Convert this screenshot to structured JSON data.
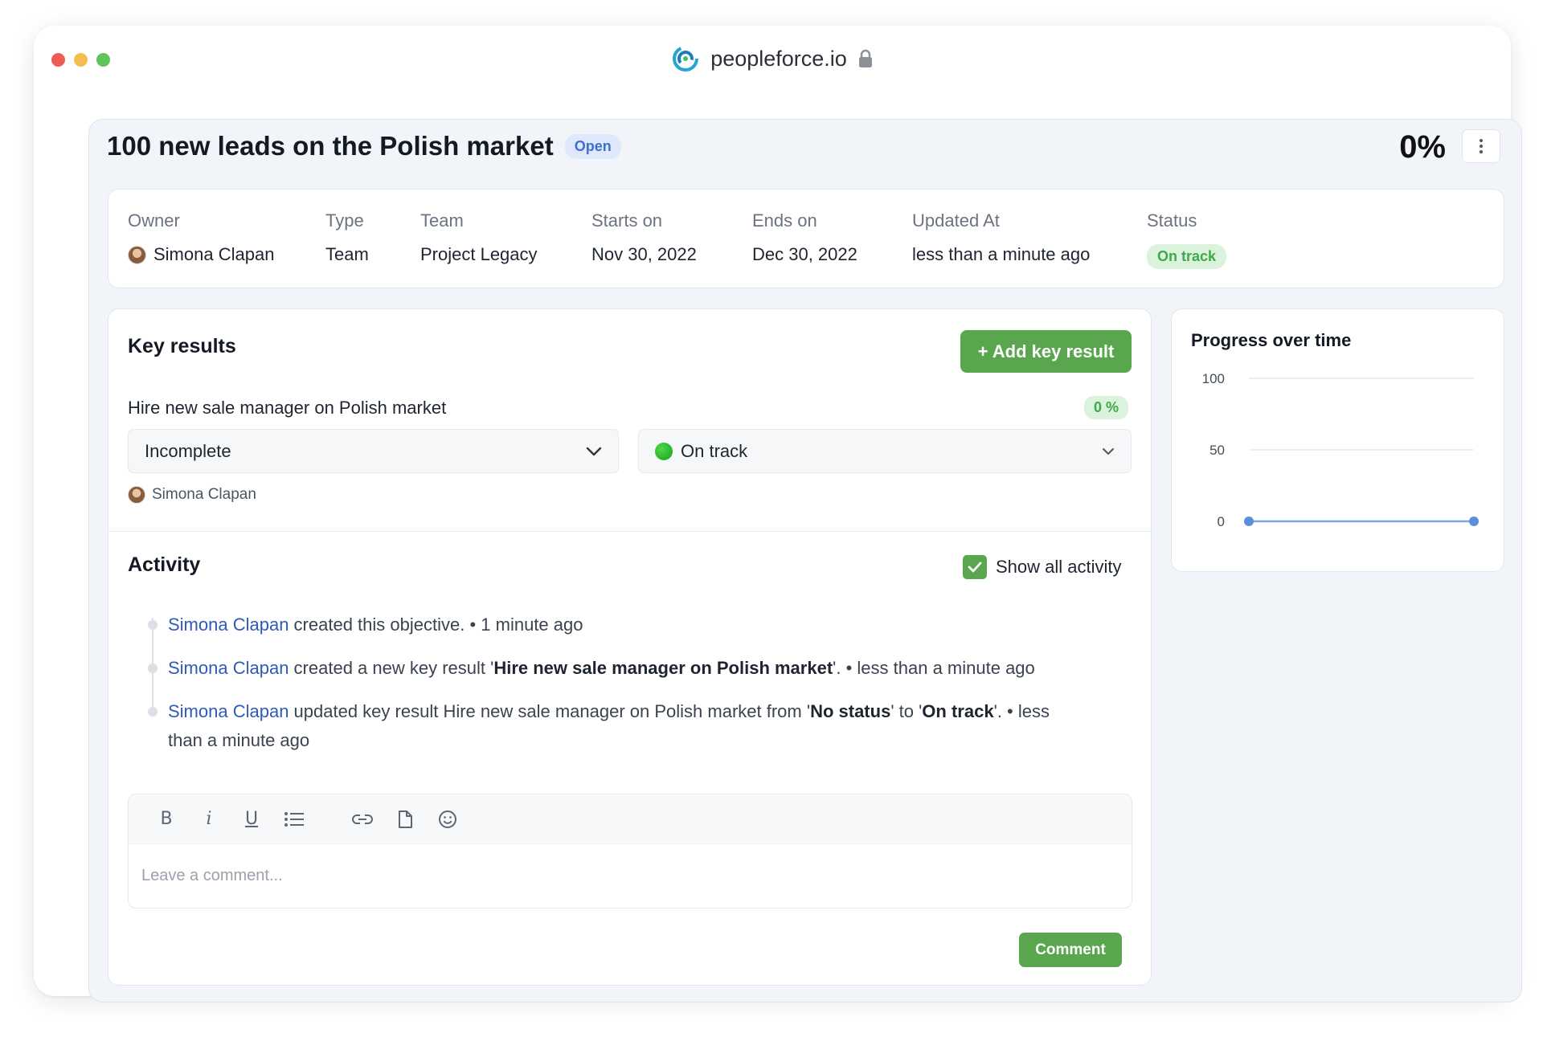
{
  "window": {
    "url": "peopleforce.io"
  },
  "objective": {
    "title": "100 new leads on the Polish market",
    "state_badge": "Open",
    "progress": "0%"
  },
  "info": {
    "owner_label": "Owner",
    "owner_value": "Simona Clapan",
    "type_label": "Type",
    "type_value": "Team",
    "team_label": "Team",
    "team_value": "Project Legacy",
    "starts_label": "Starts on",
    "starts_value": "Nov 30, 2022",
    "ends_label": "Ends on",
    "ends_value": "Dec 30, 2022",
    "updated_label": "Updated At",
    "updated_value": "less than a minute ago",
    "status_label": "Status",
    "status_value": "On track"
  },
  "key_results": {
    "title": "Key results",
    "add_button": "+ Add key result",
    "items": [
      {
        "title": "Hire new sale manager on Polish market",
        "percent": "0 %",
        "completion_select": "Incomplete",
        "status_select": "On track",
        "owner": "Simona Clapan"
      }
    ]
  },
  "activity": {
    "title": "Activity",
    "show_all_label": "Show all activity",
    "show_all_checked": true,
    "items": [
      {
        "actor": "Simona Clapan",
        "text1": " created this objective. ",
        "bold1": "",
        "text2": "",
        "bold2": "",
        "text3": "",
        "bold3": "",
        "text4": "",
        "time": " • 1 minute ago"
      },
      {
        "actor": "Simona Clapan",
        "text1": " created a new key result '",
        "bold1": "Hire new sale manager on Polish market",
        "text2": "'. ",
        "time": " • less than a minute ago"
      },
      {
        "actor": "Simona Clapan",
        "text1": " updated key result Hire new sale manager on Polish market from '",
        "bold1": "No status",
        "text2": "' to '",
        "bold2": "On track",
        "text3": "'. ",
        "time_line1": " • less",
        "time_line2": "than a minute ago"
      }
    ],
    "comment_placeholder": "Leave a comment...",
    "comment_button": "Comment",
    "toolbar_icons": [
      "bold-icon",
      "italic-icon",
      "underline-icon",
      "list-icon",
      "link-icon",
      "file-icon",
      "emoji-icon"
    ]
  },
  "progress_chart": {
    "title": "Progress over time",
    "chart_data": {
      "type": "line",
      "title": "Progress over time",
      "x": [
        0,
        1
      ],
      "series": [
        {
          "values": [
            0,
            0
          ]
        }
      ],
      "ylim": [
        0,
        100
      ],
      "yticks": [
        "100",
        "50",
        "0"
      ],
      "grid": true,
      "color": "#7aa4e0"
    }
  },
  "colors": {
    "accent_green": "#5aa64f",
    "link_blue": "#2f5bb8",
    "status_green": "#3ea84a",
    "open_blue": "#3d6fd1"
  }
}
